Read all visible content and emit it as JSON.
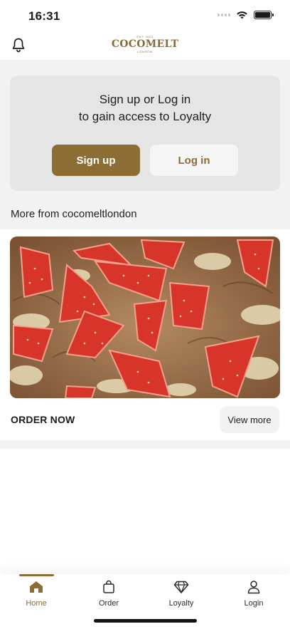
{
  "status_bar": {
    "time": "16:31"
  },
  "header": {
    "logo": {
      "est": "EST. 2022",
      "name": "COCOMELT",
      "sub": "LONDON"
    }
  },
  "login_card": {
    "line1": "Sign up or Log in",
    "line2": "to gain access to Loyalty",
    "signup_label": "Sign up",
    "login_label": "Log in"
  },
  "feed": {
    "section_title": "More from cocomeltlondon",
    "post": {
      "cta_text": "ORDER NOW",
      "view_more_label": "View more"
    }
  },
  "tabs": [
    {
      "label": "Home",
      "icon": "home-icon",
      "active": true
    },
    {
      "label": "Order",
      "icon": "bag-icon",
      "active": false
    },
    {
      "label": "Loyalty",
      "icon": "diamond-icon",
      "active": false
    },
    {
      "label": "Login",
      "icon": "user-icon",
      "active": false
    }
  ],
  "colors": {
    "brand": "#8c6d33",
    "card_bg": "#e5e5e5",
    "page_bg": "#f2f2f2"
  }
}
